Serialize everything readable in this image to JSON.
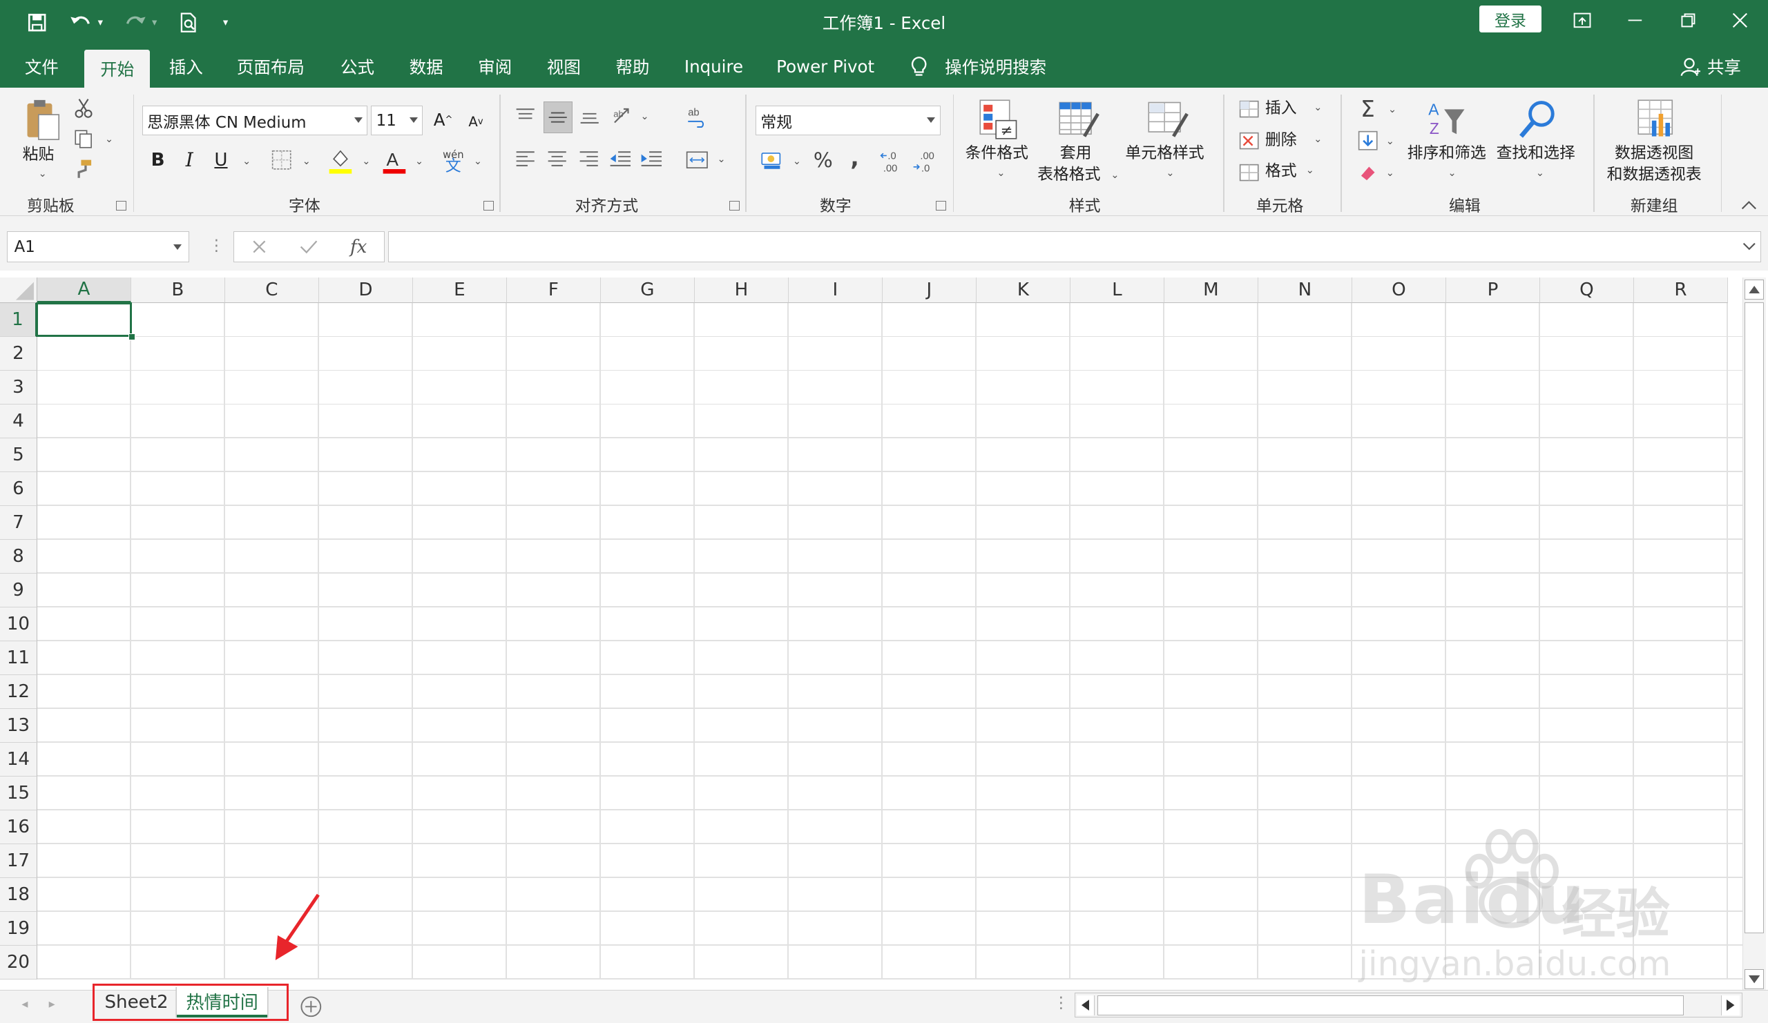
{
  "window": {
    "title": "工作簿1  -  Excel",
    "login_label": "登录"
  },
  "tabs": [
    {
      "label": "文件"
    },
    {
      "label": "开始"
    },
    {
      "label": "插入"
    },
    {
      "label": "页面布局"
    },
    {
      "label": "公式"
    },
    {
      "label": "数据"
    },
    {
      "label": "审阅"
    },
    {
      "label": "视图"
    },
    {
      "label": "帮助"
    },
    {
      "label": "Inquire"
    },
    {
      "label": "Power Pivot"
    },
    {
      "label": "操作说明搜索"
    },
    {
      "label": "共享"
    }
  ],
  "ribbon": {
    "clipboard": {
      "paste": "粘贴",
      "group": "剪贴板"
    },
    "font": {
      "name": "思源黑体 CN Medium",
      "size": "11",
      "bold": "B",
      "italic": "I",
      "underline": "U",
      "grow": "A",
      "shrink": "A",
      "phonetic_top": "wén",
      "phonetic": "文",
      "group": "字体"
    },
    "alignment": {
      "group": "对齐方式"
    },
    "number": {
      "format": "常规",
      "percent": "%",
      "comma": ",",
      "group": "数字"
    },
    "styles": {
      "conditional": "条件格式",
      "table_line1": "套用",
      "table_line2": "表格格式",
      "cell_styles": "单元格样式",
      "group": "样式"
    },
    "cells": {
      "insert": "插入",
      "delete": "删除",
      "format": "格式",
      "group": "单元格"
    },
    "editing": {
      "sort": "排序和筛选",
      "find": "查找和选择",
      "group": "编辑"
    },
    "newgroup": {
      "pivot_line1": "数据透视图",
      "pivot_line2": "和数据透视表",
      "group": "新建组"
    }
  },
  "formula_bar": {
    "name_box": "A1",
    "fx": "fx",
    "content": ""
  },
  "grid": {
    "columns": [
      "A",
      "B",
      "C",
      "D",
      "E",
      "F",
      "G",
      "H",
      "I",
      "J",
      "K",
      "L",
      "M",
      "N",
      "O",
      "P",
      "Q",
      "R"
    ],
    "rows": [
      "1",
      "2",
      "3",
      "4",
      "5",
      "6",
      "7",
      "8",
      "9",
      "10",
      "11",
      "12",
      "13",
      "14",
      "15",
      "16",
      "17",
      "18",
      "19",
      "20"
    ],
    "selected_cell": "A1"
  },
  "sheets": [
    {
      "label": "Sheet2"
    },
    {
      "label": "热情时间",
      "active": true
    }
  ],
  "watermark": {
    "brand": "Baidu",
    "cn": "经验",
    "url": "jingyan.baidu.com"
  },
  "colors": {
    "accent": "#217346",
    "annotation": "#e8252b"
  }
}
